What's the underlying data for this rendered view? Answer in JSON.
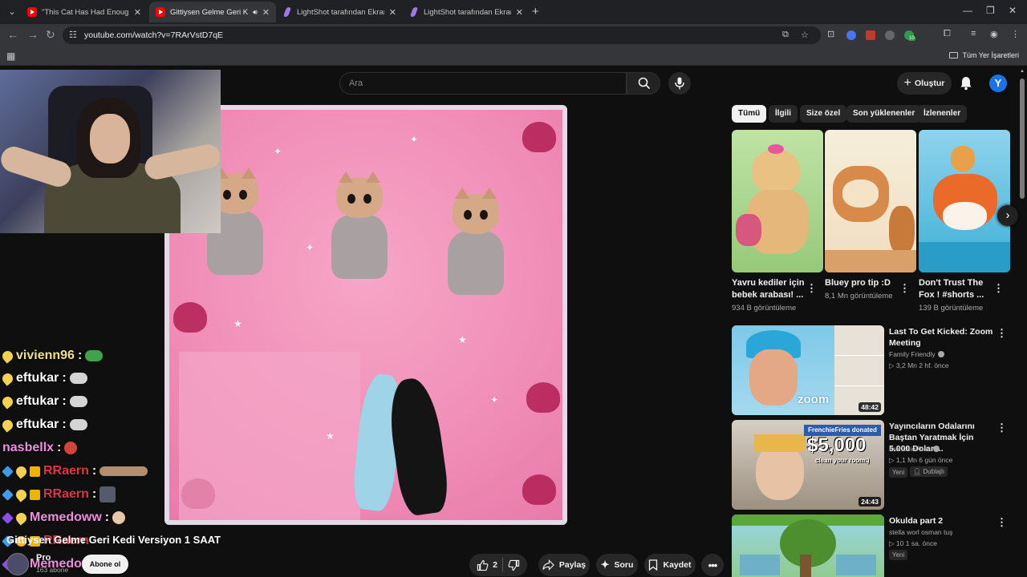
{
  "browser": {
    "tabs": [
      {
        "title": "\"This Cat Has Had Enough of O",
        "favicon": "youtube-icon",
        "active": false
      },
      {
        "title": "Gittiysen Gelme Geri Kedi V",
        "favicon": "youtube-icon",
        "active": true
      },
      {
        "title": "LightShot tarafından Ekran Gör",
        "favicon": "lightshot-icon",
        "active": false
      },
      {
        "title": "LightShot tarafından Ekran Gör",
        "favicon": "lightshot-icon",
        "active": false
      }
    ],
    "url": "youtube.com/watch?v=7RArVstD7qE",
    "bookmarks_all": "Tüm Yer İşaretleri",
    "extension_badge": "10"
  },
  "youtube": {
    "search_placeholder": "Ara",
    "create_label": "Oluştur",
    "avatar_letter": "Y",
    "accent": "#ff0000"
  },
  "video": {
    "title": "Gittiysen Gelme Geri Kedi Versiyon 1 SAAT",
    "channel": "Pro",
    "subscribers": "163 abone",
    "subscribe_label": "Abone ol",
    "actions": {
      "likes": "2",
      "share": "Paylaş",
      "ask": "Soru",
      "save": "Kaydet"
    }
  },
  "chat": [
    {
      "name": "vivienn96",
      "name_color": "#f3e27a"
    },
    {
      "name": "eftukar",
      "name_color": "#ffffff"
    },
    {
      "name": "eftukar",
      "name_color": "#ffffff"
    },
    {
      "name": "eftukar",
      "name_color": "#ffffff"
    },
    {
      "name": "nasbellx",
      "name_color": "#f28ce0"
    },
    {
      "name": "RRaern",
      "name_color": "#e0334a"
    },
    {
      "name": "RRaern",
      "name_color": "#e0334a"
    },
    {
      "name": "Memedoww",
      "name_color": "#f28ce0"
    },
    {
      "name": "RRaern",
      "name_color": "#e0334a"
    },
    {
      "name": "Memedoww",
      "name_color": "#f28ce0"
    }
  ],
  "chips": [
    "Tümü",
    "İlgili",
    "Size özel",
    "Son yüklenenler",
    "İzlenenler"
  ],
  "shorts": [
    {
      "title": "Yavru kediler için bebek arabası! ...",
      "views": "934 B görüntüleme"
    },
    {
      "title": "Bluey  pro tip :D",
      "views": "8,1 Mn görüntüleme"
    },
    {
      "title": "Don't Trust The Fox ! #shorts ...",
      "views": "139 B görüntüleme"
    }
  ],
  "recommendations": [
    {
      "title": "Last To Get Kicked: Zoom Meeting",
      "channel": "Family Friendly",
      "views": "3,2 Mn",
      "age": "2 hf. önce",
      "duration": "48:42",
      "badge": "",
      "dub": ""
    },
    {
      "title": "Yayıncıların Odalarını Baştan Yaratmak İçin 5.000 Dolar ...",
      "channel": "FrenchieFries",
      "views": "1,1 Mn",
      "age": "6 gün önce",
      "duration": "24:43",
      "badge": "Yeni",
      "dub": "Dublajlı"
    },
    {
      "title": "Okulda part 2",
      "channel": "stella worl osman tuş",
      "views": "10",
      "age": "1 sa. önce",
      "duration": "",
      "badge": "Yeni",
      "dub": ""
    }
  ],
  "thumbnail_text": {
    "rec1_logo": "zoom",
    "rec2_donation": "FrenchieFries donated",
    "rec2_amount": "$5,000",
    "rec2_caption": "clean your room:)"
  }
}
